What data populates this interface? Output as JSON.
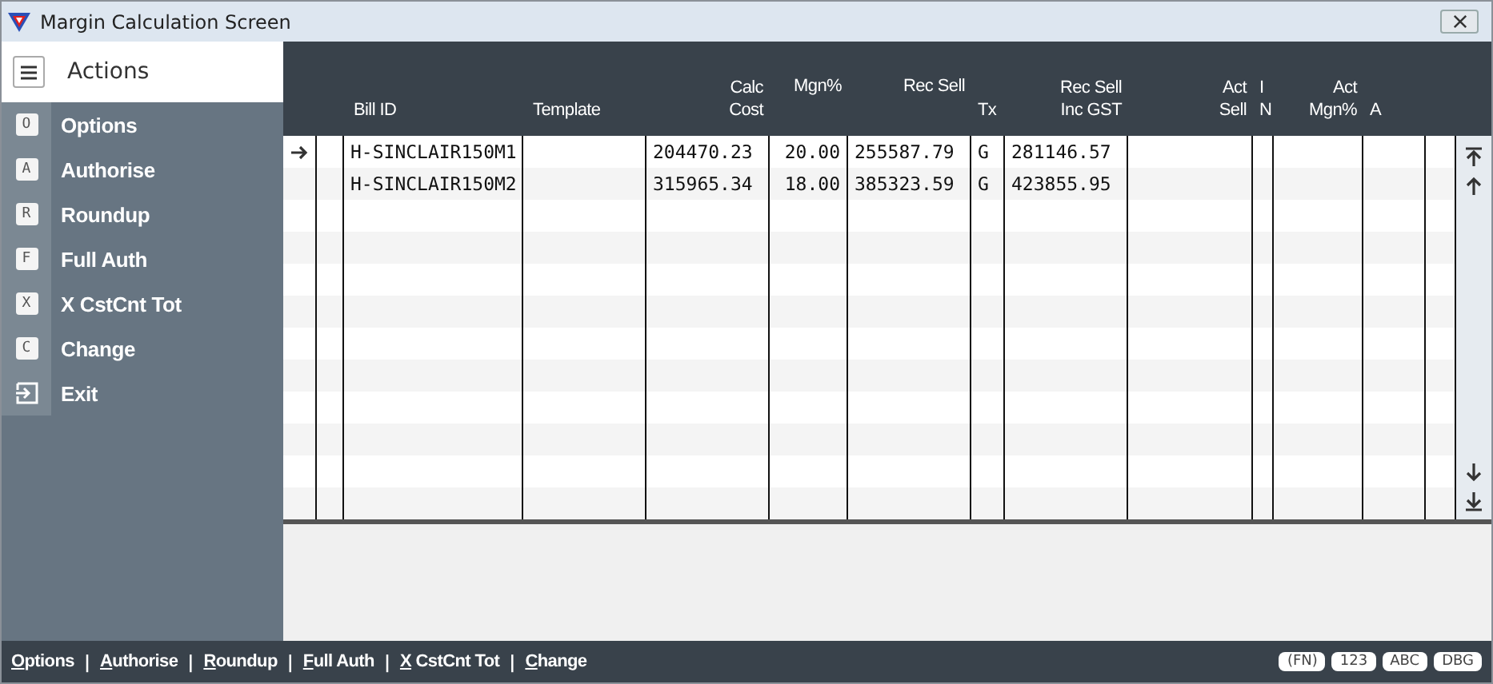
{
  "window": {
    "title": "Margin Calculation Screen"
  },
  "sidebar": {
    "title": "Actions",
    "items": [
      {
        "kind": "key",
        "key": "O",
        "label": "Options"
      },
      {
        "kind": "key",
        "key": "A",
        "label": "Authorise"
      },
      {
        "kind": "key",
        "key": "R",
        "label": "Roundup"
      },
      {
        "kind": "key",
        "key": "F",
        "label": "Full Auth"
      },
      {
        "kind": "key",
        "key": "X",
        "label": "X CstCnt Tot"
      },
      {
        "kind": "key",
        "key": "C",
        "label": "Change"
      },
      {
        "kind": "exit",
        "label": "Exit"
      }
    ]
  },
  "table": {
    "columns": [
      {},
      {},
      {
        "lines": [
          "Bill ID"
        ]
      },
      {
        "lines": [
          "Template"
        ]
      },
      {
        "lines": [
          "Calc",
          "Cost"
        ]
      },
      {
        "lines": [
          "Mgn%"
        ]
      },
      {
        "lines": [
          "Rec Sell"
        ]
      },
      {
        "lines": [
          "Tx"
        ]
      },
      {
        "lines": [
          "Rec Sell",
          "Inc GST"
        ]
      },
      {
        "lines": [
          "Act",
          "Sell"
        ]
      },
      {
        "lines": [
          "I",
          "N"
        ]
      },
      {
        "lines": [
          "Act",
          "Mgn%"
        ]
      },
      {
        "lines": [
          "A"
        ]
      }
    ],
    "rows": [
      {
        "selected": true,
        "cells": [
          "",
          "",
          "H-SINCLAIR150M1",
          "",
          "204470.23",
          "20.00",
          "255587.79",
          "G",
          "281146.57",
          "",
          "",
          "",
          ""
        ]
      },
      {
        "selected": false,
        "cells": [
          "",
          "",
          "H-SINCLAIR150M2",
          "",
          "315965.34",
          "18.00",
          "385323.59",
          "G",
          "423855.95",
          "",
          "",
          "",
          ""
        ]
      }
    ]
  },
  "status_bar": {
    "links": [
      {
        "label": "Options"
      },
      {
        "separator": "|",
        "label": "Authorise"
      },
      {
        "separator": "|",
        "label": "Roundup"
      },
      {
        "separator": "|",
        "label": "Full Auth"
      },
      {
        "separator": "|",
        "label": "X CstCnt Tot"
      },
      {
        "separator": "|",
        "label": "Change"
      }
    ],
    "badges": [
      "(FN)",
      "123",
      "ABC",
      "DBG"
    ]
  }
}
